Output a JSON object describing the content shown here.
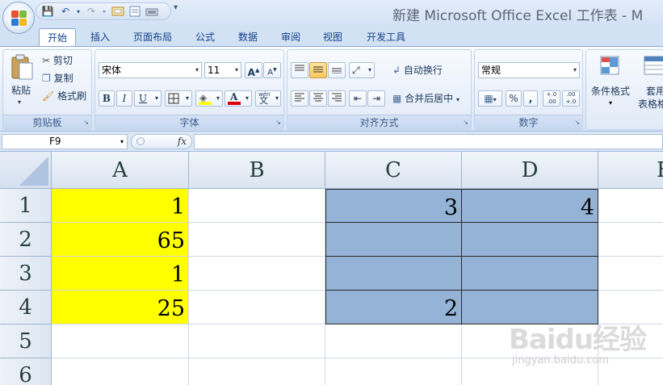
{
  "window": {
    "title": "新建 Microsoft Office Excel 工作表 - M"
  },
  "quick_access": {
    "save_icon": "save-icon",
    "undo_icon": "undo-icon",
    "redo_icon": "redo-icon",
    "customize_icon": "chevron-down-icon"
  },
  "tabs": [
    "开始",
    "插入",
    "页面布局",
    "公式",
    "数据",
    "审阅",
    "视图",
    "开发工具"
  ],
  "ribbon": {
    "clipboard": {
      "label": "剪贴板",
      "paste": "粘贴",
      "cut": "剪切",
      "copy": "复制",
      "format_painter": "格式刷"
    },
    "font": {
      "label": "字体",
      "font_name": "宋体",
      "font_size": "11",
      "grow": "A",
      "shrink": "A",
      "bold": "B",
      "italic": "I",
      "underline": "U",
      "font_color_letter": "A",
      "phonetic_top": "wén",
      "phonetic_bottom": "文"
    },
    "alignment": {
      "label": "对齐方式",
      "wrap_text": "自动换行",
      "merge_center": "合并后居中"
    },
    "number": {
      "label": "数字",
      "format": "常规",
      "percent": "%",
      "comma": ",",
      "inc_decimal": "+.0 .00",
      "dec_decimal": ".00 +.0"
    },
    "styles": {
      "conditional_format": "条件格式",
      "table_format_line1": "套用",
      "table_format_line2": "表格格"
    }
  },
  "formula_bar": {
    "name_box": "F9",
    "fx": "fx",
    "content": ""
  },
  "sheet": {
    "columns": [
      "A",
      "B",
      "C",
      "D",
      "E"
    ],
    "rows": [
      "1",
      "2",
      "3",
      "4",
      "5",
      "6"
    ],
    "cells": {
      "A1": "1",
      "A2": "65",
      "A3": "1",
      "A4": "25",
      "C1": "3",
      "D1": "4",
      "C4": "2"
    },
    "colors": {
      "yellow": "#ffff00",
      "blue": "#95b3d7"
    }
  },
  "watermark": {
    "logo": "Baidu经验",
    "url": "jingyan.baidu.com"
  }
}
